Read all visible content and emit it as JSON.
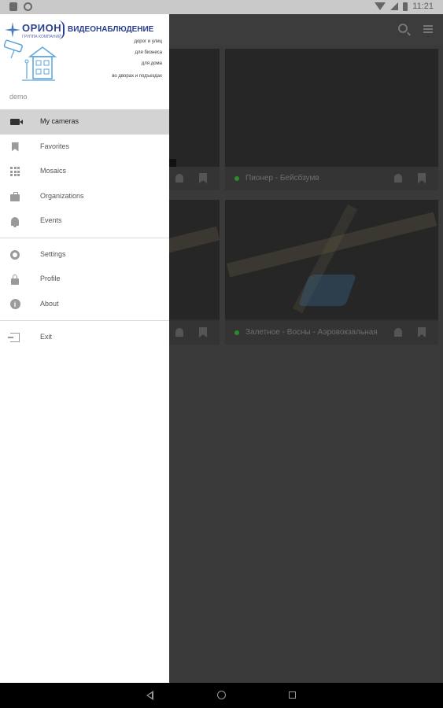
{
  "status_bar": {
    "time": "11:21"
  },
  "drawer": {
    "header": {
      "brand": "ОРИОН",
      "brand_sub": "ГРУППА КОМПАНИЙ",
      "headline": "ВИДЕОНАБЛЮДЕНИЕ",
      "lines": [
        "дорог и улиц",
        "для бизнеса",
        "для дома",
        "во дворах и подъездах"
      ],
      "username": "demo"
    },
    "items_primary": [
      {
        "label": "My cameras",
        "icon": "videocam-icon",
        "active": true
      },
      {
        "label": "Favorites",
        "icon": "bookmark-icon"
      },
      {
        "label": "Mosaics",
        "icon": "grid-icon"
      },
      {
        "label": "Organizations",
        "icon": "briefcase-icon"
      },
      {
        "label": "Events",
        "icon": "bell-icon"
      }
    ],
    "items_secondary": [
      {
        "label": "Settings",
        "icon": "gear-icon"
      },
      {
        "label": "Profile",
        "icon": "lock-icon"
      },
      {
        "label": "About",
        "icon": "info-icon"
      }
    ],
    "items_tertiary": [
      {
        "label": "Exit",
        "icon": "exit-icon"
      }
    ]
  },
  "background": {
    "cards": [
      {
        "title": ""
      },
      {
        "title": "Пионер - Бейсбзумв"
      },
      {
        "title": ""
      },
      {
        "title": "Залетное - Восны - Аэровокзальная"
      }
    ]
  },
  "colors": {
    "active_item_bg": "#d3d3d3",
    "brand_blue": "#2b3f8f",
    "status_green": "#2e8a2e"
  }
}
